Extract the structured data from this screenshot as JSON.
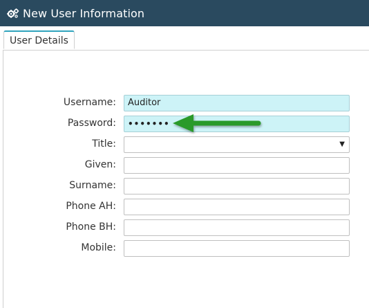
{
  "window": {
    "title": "New User Information",
    "title_icon": "cogs-icon"
  },
  "tabs": [
    {
      "label": "User Details",
      "active": true
    }
  ],
  "form": {
    "username": {
      "label": "Username:",
      "value": "Auditor"
    },
    "password": {
      "label": "Password:",
      "value": "•••••••"
    },
    "title": {
      "label": "Title:",
      "value": ""
    },
    "given": {
      "label": "Given:",
      "value": ""
    },
    "surname": {
      "label": "Surname:",
      "value": ""
    },
    "phone_ah": {
      "label": "Phone AH:",
      "value": ""
    },
    "phone_bh": {
      "label": "Phone BH:",
      "value": ""
    },
    "mobile": {
      "label": "Mobile:",
      "value": ""
    }
  },
  "annotation": {
    "arrow_color": "#2a9a2a",
    "arrow_points_to": "password"
  },
  "colors": {
    "titlebar": "#2a4a5f",
    "filled_field": "#cdf3f7",
    "tab_accent": "#2ea3bd"
  }
}
